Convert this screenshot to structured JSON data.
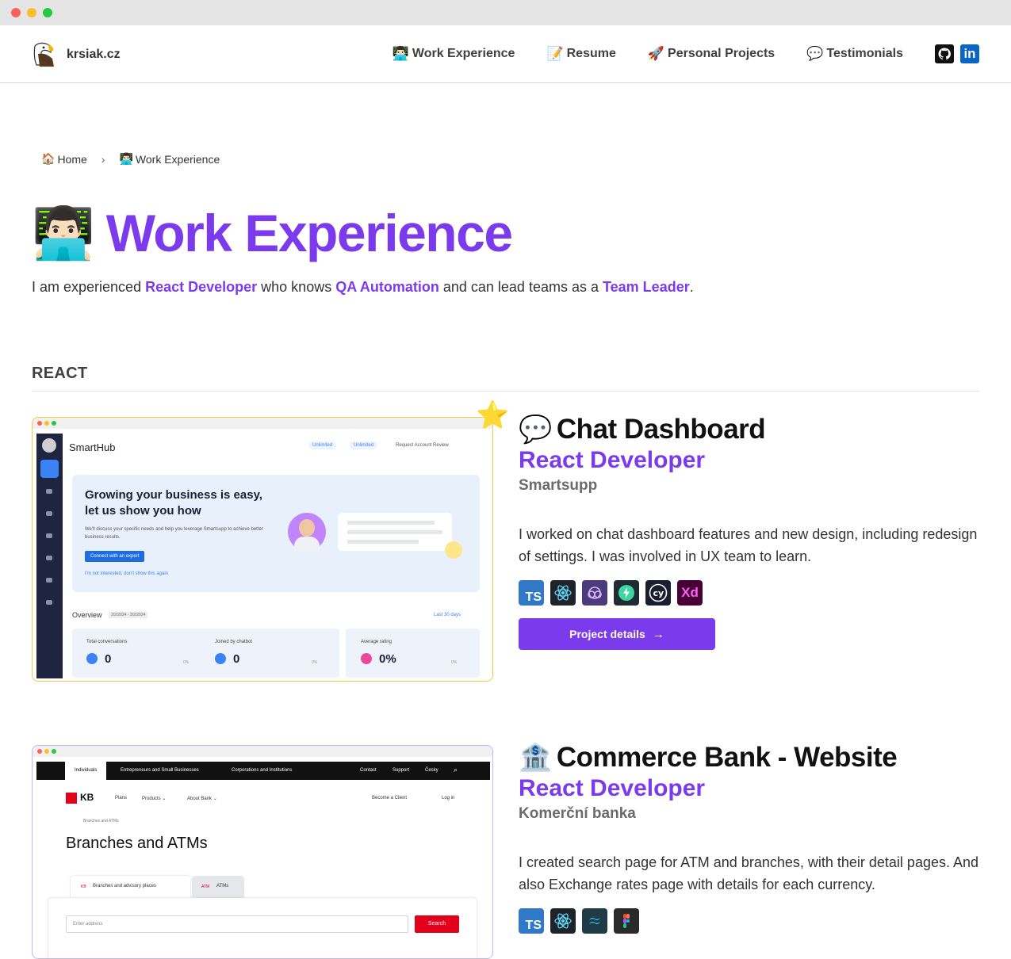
{
  "header": {
    "brand": "krsiak.cz",
    "nav": [
      {
        "emoji": "👨🏻‍💻",
        "label": "Work Experience"
      },
      {
        "emoji": "📝",
        "label": "Resume"
      },
      {
        "emoji": "🚀",
        "label": "Personal Projects"
      },
      {
        "emoji": "💬",
        "label": "Testimonials"
      }
    ],
    "social": {
      "linkedin": "in"
    }
  },
  "breadcrumb": {
    "home": {
      "emoji": "🏠",
      "label": "Home"
    },
    "separator": "›",
    "current": {
      "emoji": "👨🏻‍💻",
      "label": "Work Experience"
    }
  },
  "hero": {
    "emoji": "👨🏻‍💻",
    "title": "Work Experience",
    "intro": {
      "p1": "I am experienced ",
      "h1": "React Developer",
      "p2": " who knows ",
      "h2": "QA Automation",
      "p3": " and can lead teams as a ",
      "h3": "Team Leader",
      "p4": "."
    }
  },
  "section": {
    "heading": "REACT"
  },
  "projects": [
    {
      "emoji": "💬",
      "title": "Chat Dashboard",
      "role": "React Developer",
      "company": "Smartsupp",
      "description": "I worked on chat dashboard features and new design, including redesign of settings. I was involved in UX team to learn.",
      "tech": [
        "TS",
        "",
        "",
        "",
        "cy",
        "Xd"
      ],
      "button": "Project details",
      "screenshot": {
        "app_name": "SmartHub",
        "pill1": "Unlimited",
        "pill2": "Unlimited",
        "account_link": "Request Account Review",
        "banner_title": "Growing your business is easy, let us show you how",
        "banner_text": "We'll discuss your specific needs and help you leverage Smartsupp to achieve better business results.",
        "banner_button": "Connect with an expert",
        "banner_link": "I'm not interested, don't show this again",
        "overview": "Overview",
        "date_range": "2/2/2024 - 3/2/2024",
        "period": "Last 30 days",
        "stats": [
          {
            "label": "Total conversations",
            "value": "0",
            "delta": "0%"
          },
          {
            "label": "Joined by chatbot",
            "value": "0",
            "delta": "0%"
          },
          {
            "label": "Average rating",
            "value": "0%",
            "delta": "0%"
          }
        ]
      }
    },
    {
      "emoji": "🏦",
      "title": "Commerce Bank - Website",
      "role": "React Developer",
      "company": "Komerční banka",
      "description": "I created search page for ATM and branches, with their detail pages. And also Exchange rates page with details for each currency.",
      "tech": [
        "TS",
        "",
        "",
        ""
      ],
      "screenshot": {
        "topbar": [
          "Individuals",
          "Entrepreneurs and Small Businesses",
          "Corporations and Institutions"
        ],
        "topbar_right": [
          "Contact",
          "Support",
          "Česky"
        ],
        "logo": "KB",
        "menu": [
          "Plans",
          "Products ⌄",
          "About Bank ⌄"
        ],
        "become_client": "Become a Client",
        "login": "Log in",
        "crumb": "Branches and ATMs",
        "heading": "Branches and ATMs",
        "tabs": [
          "Branches and advisory places",
          "ATMs"
        ],
        "tab_icons": [
          "KB",
          "ATM"
        ],
        "input_placeholder": "Enter address",
        "search_button": "Search"
      }
    }
  ],
  "colors": {
    "accent": "#7c3aed",
    "star_border": "#f2c94c",
    "dark_text": "#111111"
  }
}
